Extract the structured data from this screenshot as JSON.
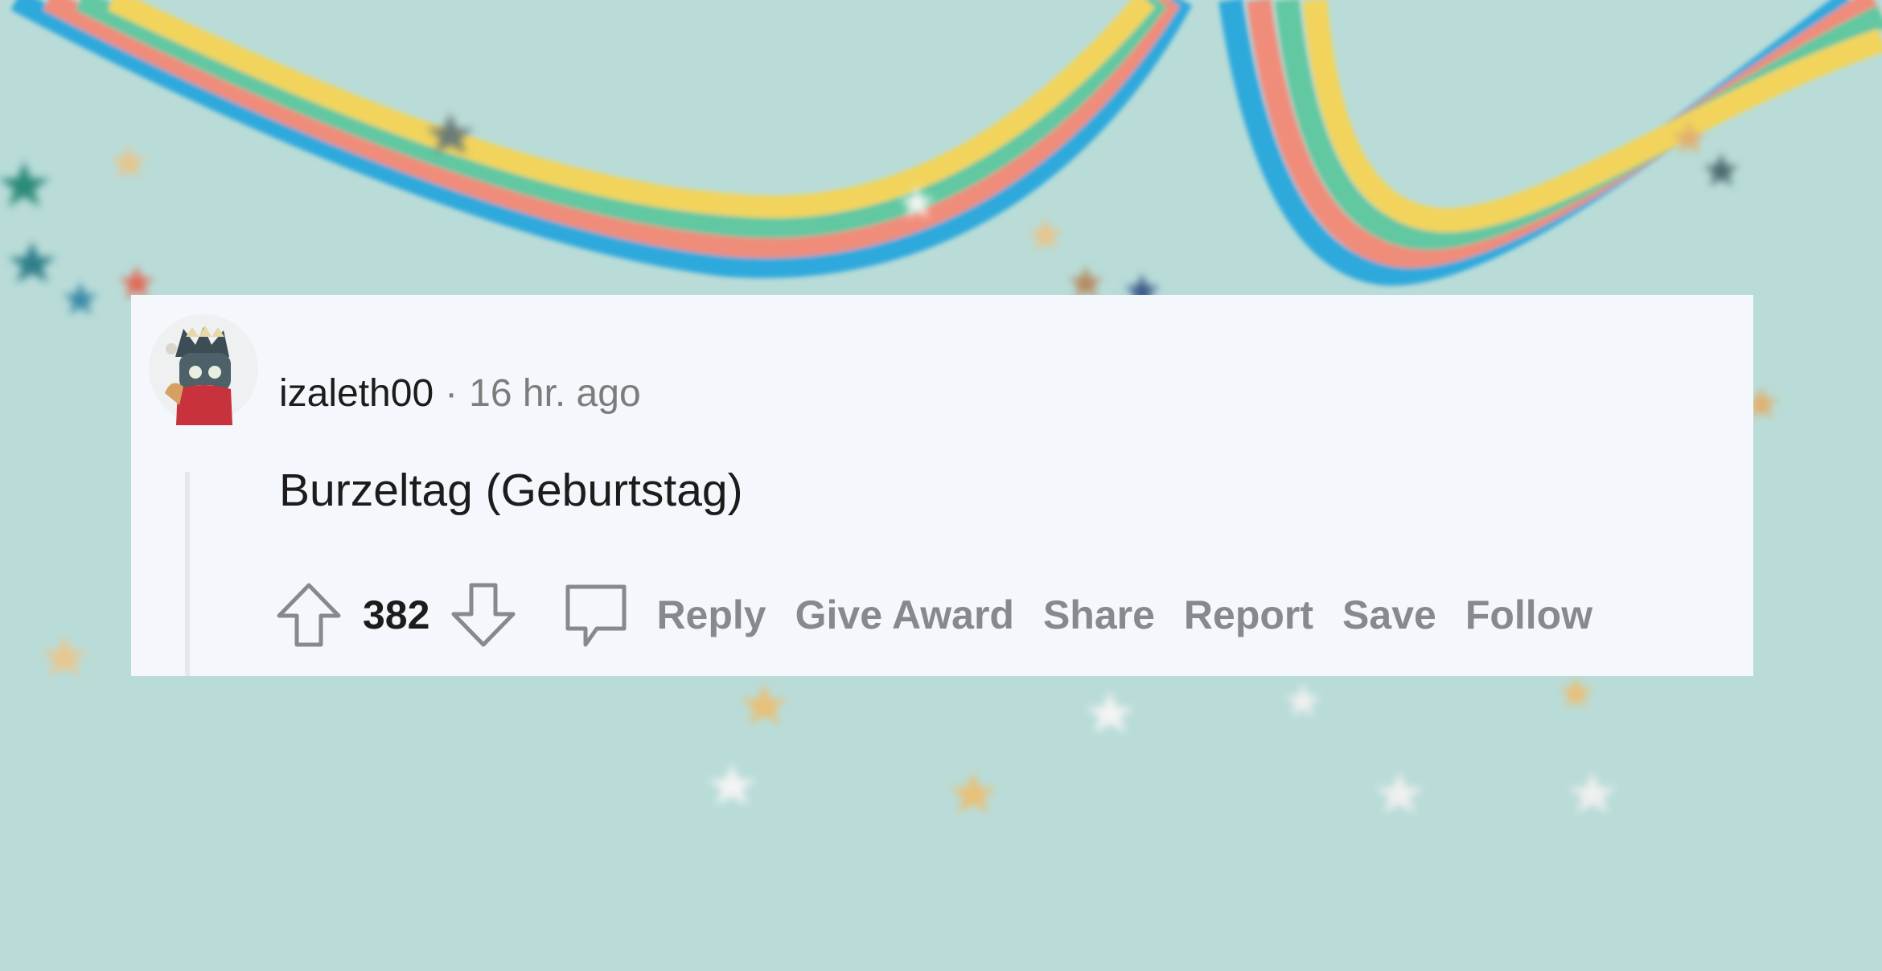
{
  "comment": {
    "username": "izaleth00",
    "separator": "·",
    "timestamp": "16 hr. ago",
    "body": "Burzeltag (Geburtstag)",
    "score": "382"
  },
  "actions": {
    "reply": "Reply",
    "give_award": "Give Award",
    "share": "Share",
    "report": "Report",
    "save": "Save",
    "follow": "Follow"
  },
  "icons": {
    "upvote": "upvote-arrow-icon",
    "downvote": "downvote-arrow-icon",
    "comment": "comment-bubble-icon",
    "avatar": "user-avatar"
  },
  "colors": {
    "background": "#b9dcd8",
    "card": "#f4f7fb",
    "ribbon_blue": "#2ea9dc",
    "ribbon_coral": "#f08c7a",
    "ribbon_green": "#62c8a2",
    "ribbon_yellow": "#f2d45c",
    "action_gray": "#878a8c"
  }
}
